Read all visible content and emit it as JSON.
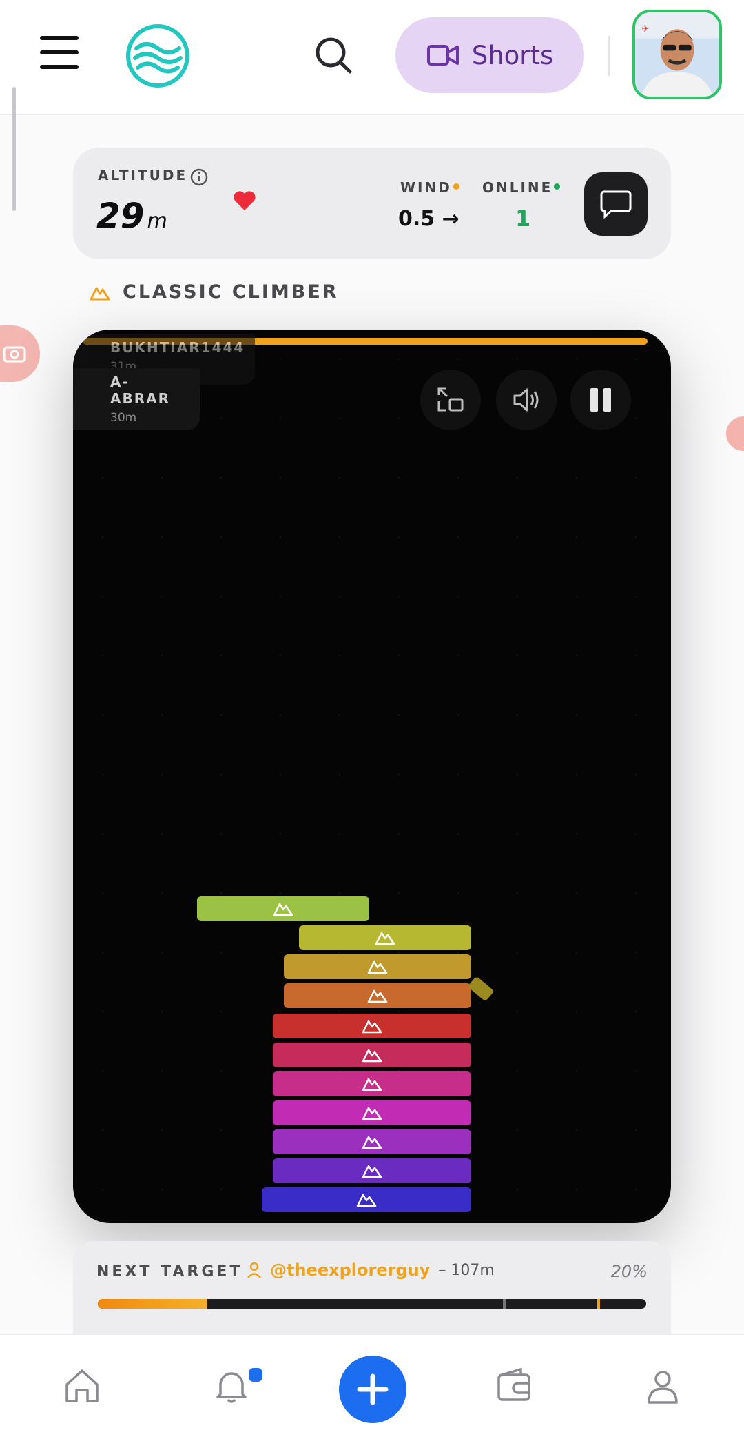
{
  "header": {
    "menu_icon": "hamburger-icon",
    "logo_icon": "waves-logo-icon",
    "search_icon": "search-icon",
    "shorts_label": "Shorts",
    "shorts_icon": "video-camera-icon",
    "avatar": "user-avatar"
  },
  "status": {
    "altitude_label": "ALTITUDE",
    "altitude_value": "29",
    "altitude_unit": "m",
    "heart_icon": "heart-icon",
    "wind_label": "WIND",
    "wind_value": "0.5 →",
    "online_label": "ONLINE",
    "online_value": "1",
    "chat_icon": "chat-bubble-icon"
  },
  "mode": {
    "label": "CLASSIC CLIMBER",
    "icon": "mountain-icon"
  },
  "game": {
    "players": [
      {
        "name": "BUKHTIAR1444",
        "altitude": "31m"
      },
      {
        "name": "A-ABRAR",
        "altitude": "30m"
      }
    ],
    "controls": [
      {
        "icon": "exit-fullscreen-icon"
      },
      {
        "icon": "volume-icon"
      },
      {
        "icon": "pause-icon"
      }
    ],
    "block_colors": [
      "#9bc244",
      "#b6b832",
      "#c19a2e",
      "#c86a2e",
      "#c8302e",
      "#c52c5c",
      "#c72e8a",
      "#c22cb4",
      "#9b2fbe",
      "#6a2cc0",
      "#3a2cc6"
    ],
    "block_icon": "mountain-icon"
  },
  "target": {
    "label": "NEXT TARGET",
    "user_icon": "person-icon",
    "handle": "@theexplorerguy",
    "distance": "– 107m",
    "percent": "20%",
    "progress": 0.2
  },
  "nav": {
    "items": [
      "home-icon",
      "bell-icon",
      "add-icon",
      "wallet-icon",
      "profile-icon"
    ],
    "accent": "#1c6df0"
  }
}
